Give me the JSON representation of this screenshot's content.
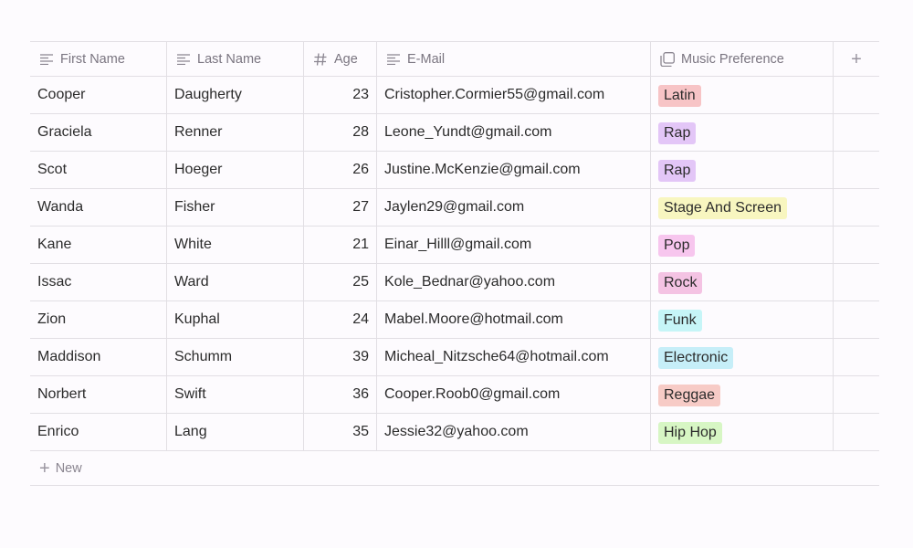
{
  "columns": [
    {
      "label": "First Name",
      "icon": "text-lines-icon"
    },
    {
      "label": "Last Name",
      "icon": "text-lines-icon"
    },
    {
      "label": "Age",
      "icon": "hash-icon"
    },
    {
      "label": "E-Mail",
      "icon": "text-lines-icon"
    },
    {
      "label": "Music Preference",
      "icon": "multi-select-icon"
    }
  ],
  "add_column_glyph": "+",
  "rows": [
    {
      "first": "Cooper",
      "last": "Daugherty",
      "age": "23",
      "email": "Cristopher.Cormier55@gmail.com",
      "music": "Latin"
    },
    {
      "first": "Graciela",
      "last": "Renner",
      "age": "28",
      "email": "Leone_Yundt@gmail.com",
      "music": "Rap"
    },
    {
      "first": "Scot",
      "last": "Hoeger",
      "age": "26",
      "email": "Justine.McKenzie@gmail.com",
      "music": "Rap"
    },
    {
      "first": "Wanda",
      "last": "Fisher",
      "age": "27",
      "email": "Jaylen29@gmail.com",
      "music": "Stage And Screen"
    },
    {
      "first": "Kane",
      "last": "White",
      "age": "21",
      "email": "Einar_Hilll@gmail.com",
      "music": "Pop"
    },
    {
      "first": "Issac",
      "last": "Ward",
      "age": "25",
      "email": "Kole_Bednar@yahoo.com",
      "music": "Rock"
    },
    {
      "first": "Zion",
      "last": "Kuphal",
      "age": "24",
      "email": "Mabel.Moore@hotmail.com",
      "music": "Funk"
    },
    {
      "first": "Maddison",
      "last": "Schumm",
      "age": "39",
      "email": "Micheal_Nitzsche64@hotmail.com",
      "music": "Electronic"
    },
    {
      "first": "Norbert",
      "last": "Swift",
      "age": "36",
      "email": "Cooper.Roob0@gmail.com",
      "music": "Reggae"
    },
    {
      "first": "Enrico",
      "last": "Lang",
      "age": "35",
      "email": "Jessie32@yahoo.com",
      "music": "Hip Hop"
    }
  ],
  "tag_colors": {
    "Latin": "#f7c4c6",
    "Rap": "#e3c6f7",
    "Stage And Screen": "#f8f6c0",
    "Pop": "#f7c6ee",
    "Rock": "#f4c3e3",
    "Funk": "#c6f5f7",
    "Electronic": "#c6eef8",
    "Reggae": "#f7cbc6",
    "Hip Hop": "#d7f6c4"
  },
  "new_row": {
    "glyph": "+",
    "label": "New"
  }
}
